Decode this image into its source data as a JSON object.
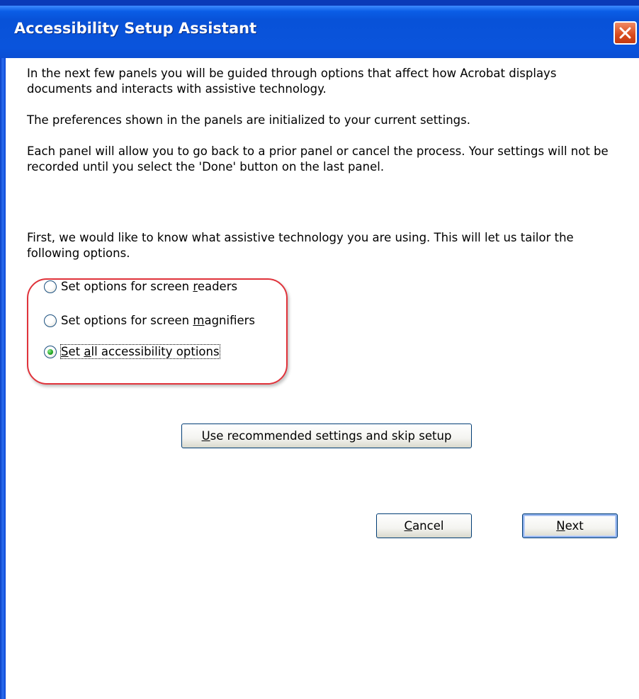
{
  "window": {
    "title": "Accessibility Setup Assistant"
  },
  "intro": {
    "para1": "In the next few panels you will be guided through options that affect how Acrobat displays documents and interacts with assistive technology.",
    "para2": "The preferences shown in the panels are initialized to your current settings.",
    "para3": "Each panel will allow you to go back to a prior panel or cancel the process. Your settings will not be recorded until you select the 'Done' button on the last panel.",
    "para4": "First, we would like to know what assistive technology you are using. This will let us tailor the following options."
  },
  "options": {
    "screen_readers": {
      "pre": "Set options for screen ",
      "mnemonic": "r",
      "post": "eaders",
      "checked": false
    },
    "screen_magnifiers": {
      "pre": "Set options for screen ",
      "mnemonic": "m",
      "post": "agnifiers",
      "checked": false
    },
    "all_options": {
      "pre": "",
      "mnemonic": "S",
      "post": "et ",
      "mnemonic2": "a",
      "post2": "ll accessibility options",
      "checked": true
    }
  },
  "buttons": {
    "skip": {
      "mnemonic": "U",
      "rest": "se recommended settings and skip setup"
    },
    "cancel": {
      "mnemonic": "C",
      "rest": "ancel"
    },
    "next": {
      "mnemonic": "N",
      "rest": "ext"
    }
  },
  "colors": {
    "title_bar": "#0a54dc",
    "close_button": "#d94a1c",
    "highlight_ring": "#e0323a",
    "radio_selected": "#21a121"
  }
}
